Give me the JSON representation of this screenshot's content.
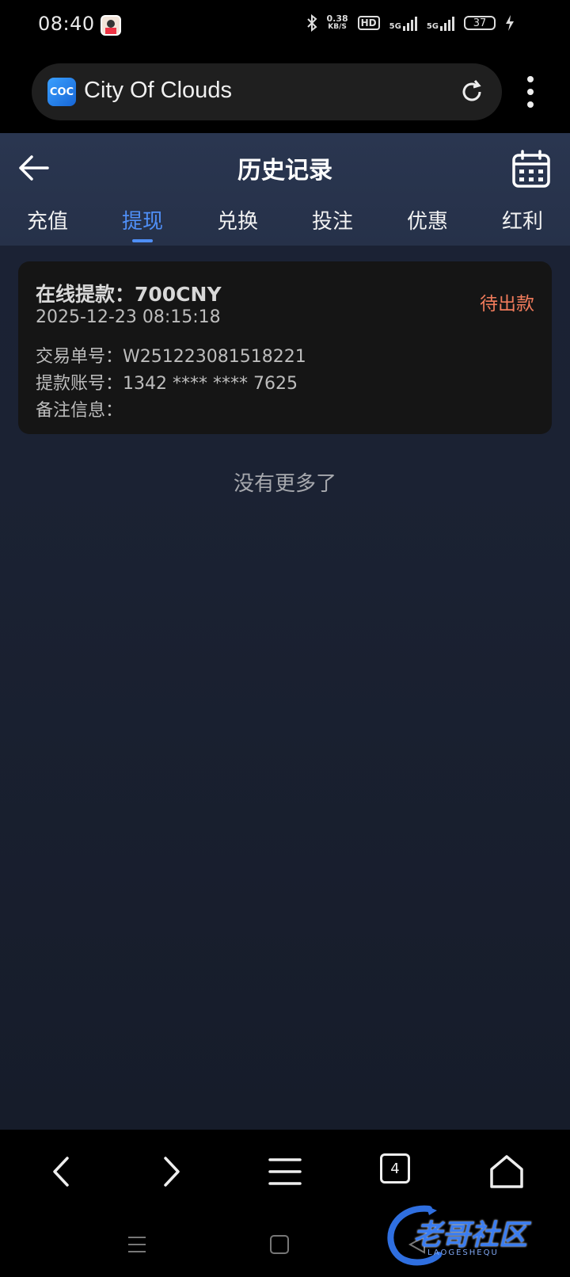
{
  "status_bar": {
    "time": "08:40",
    "net_speed": "0.38",
    "net_unit": "KB/S",
    "hd_label": "HD",
    "signal1_label": "5G",
    "signal2_label": "5G",
    "battery": "37"
  },
  "browser": {
    "url_title": "City Of Clouds",
    "site_logo_text": "COC",
    "tab_count": "4"
  },
  "app": {
    "title": "历史记录",
    "tabs": [
      {
        "label": "充值"
      },
      {
        "label": "提现"
      },
      {
        "label": "兑换"
      },
      {
        "label": "投注"
      },
      {
        "label": "优惠"
      },
      {
        "label": "红利"
      }
    ],
    "active_tab_index": 1,
    "accent_color": "#4f8ff7",
    "status_color": "#f07b5b"
  },
  "record": {
    "title": "在线提款：700CNY",
    "status": "待出款",
    "datetime": "2025-12-23 08:15:18",
    "txn_label": "交易单号：",
    "txn_value": "W251223081518221",
    "account_label": "提款账号：",
    "account_value": "1342 **** **** 7625",
    "note_label": "备注信息："
  },
  "list_end_text": "没有更多了",
  "watermark": {
    "text": "老哥社区",
    "subtext": "LAOGESHEQU"
  }
}
